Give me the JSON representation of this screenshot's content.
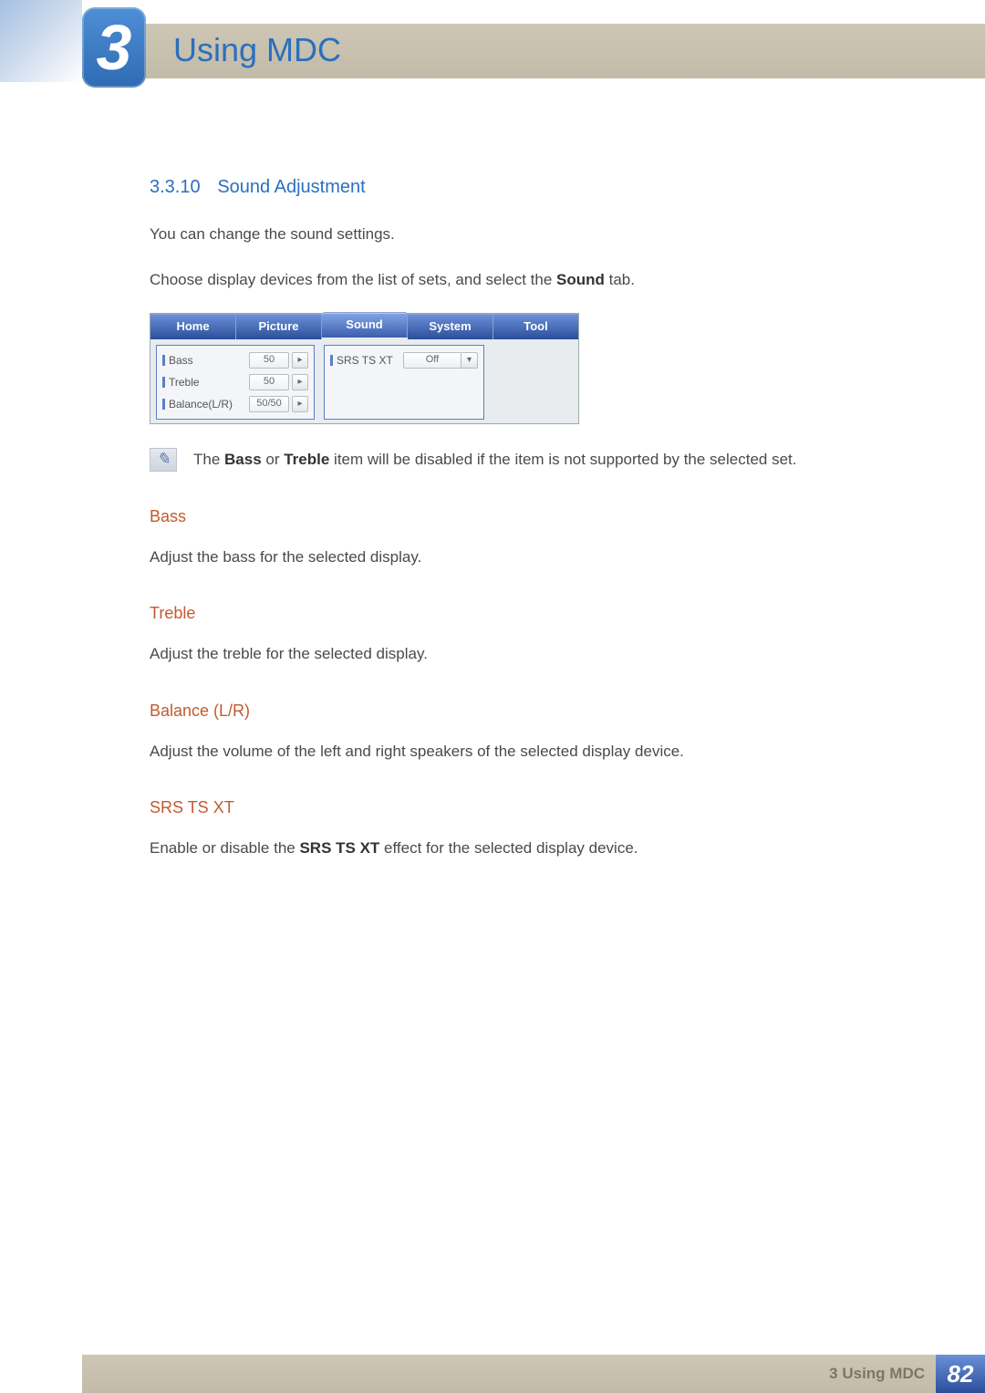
{
  "chapter": {
    "number": "3",
    "title": "Using MDC"
  },
  "section": {
    "number": "3.3.10",
    "title": "Sound Adjustment"
  },
  "intro1": "You can change the sound settings.",
  "intro2_a": "Choose display devices from the list of sets, and select the ",
  "intro2_bold": "Sound",
  "intro2_b": " tab.",
  "panel": {
    "tabs": [
      "Home",
      "Picture",
      "Sound",
      "System",
      "Tool"
    ],
    "rows": [
      {
        "label": "Bass",
        "value": "50"
      },
      {
        "label": "Treble",
        "value": "50"
      },
      {
        "label": "Balance(L/R)",
        "value": "50/50"
      }
    ],
    "srs": {
      "label": "SRS TS XT",
      "value": "Off"
    }
  },
  "note_a": "The ",
  "note_b1": "Bass",
  "note_mid": " or ",
  "note_b2": "Treble",
  "note_c": " item will be disabled if the item is not supported by the selected set.",
  "subs": {
    "bass": {
      "h": "Bass",
      "p": "Adjust the bass for the selected display."
    },
    "treble": {
      "h": "Treble",
      "p": "Adjust the treble for the selected display."
    },
    "balance": {
      "h": "Balance (L/R)",
      "p": "Adjust the volume of the left and right speakers of the selected display device."
    },
    "srs": {
      "h": "SRS TS XT",
      "p_a": "Enable or disable the ",
      "p_bold": "SRS TS XT",
      "p_b": " effect for the selected display device."
    }
  },
  "footer": {
    "text": "3 Using MDC",
    "page": "82"
  }
}
